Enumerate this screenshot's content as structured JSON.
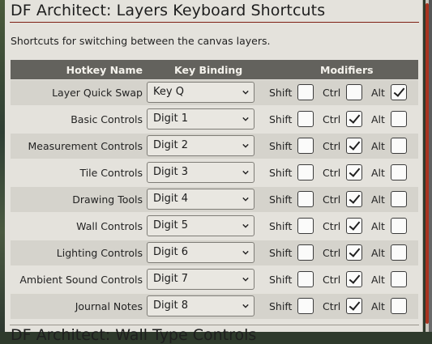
{
  "panel": {
    "title": "DF Architect: Layers Keyboard Shortcuts",
    "description": "Shortcuts for switching between the canvas layers.",
    "next_section_title": "DF Architect: Wall Type Controls"
  },
  "table": {
    "headers": {
      "name": "Hotkey Name",
      "binding": "Key Binding",
      "modifiers": "Modifiers"
    },
    "modifier_labels": {
      "shift": "Shift",
      "ctrl": "Ctrl",
      "alt": "Alt"
    },
    "rows": [
      {
        "name": "Layer Quick Swap",
        "binding": "Key Q",
        "shift": false,
        "ctrl": false,
        "alt": true
      },
      {
        "name": "Basic Controls",
        "binding": "Digit 1",
        "shift": false,
        "ctrl": true,
        "alt": false
      },
      {
        "name": "Measurement Controls",
        "binding": "Digit 2",
        "shift": false,
        "ctrl": true,
        "alt": false
      },
      {
        "name": "Tile Controls",
        "binding": "Digit 3",
        "shift": false,
        "ctrl": true,
        "alt": false
      },
      {
        "name": "Drawing Tools",
        "binding": "Digit 4",
        "shift": false,
        "ctrl": true,
        "alt": false
      },
      {
        "name": "Wall Controls",
        "binding": "Digit 5",
        "shift": false,
        "ctrl": true,
        "alt": false
      },
      {
        "name": "Lighting Controls",
        "binding": "Digit 6",
        "shift": false,
        "ctrl": true,
        "alt": false
      },
      {
        "name": "Ambient Sound Controls",
        "binding": "Digit 7",
        "shift": false,
        "ctrl": true,
        "alt": false
      },
      {
        "name": "Journal Notes",
        "binding": "Digit 8",
        "shift": false,
        "ctrl": true,
        "alt": false
      }
    ]
  },
  "colors": {
    "accent": "#7e1f13",
    "header_bg": "#63625d",
    "panel_bg": "#e4e2dc",
    "row_alt_bg": "#d5d3cc"
  },
  "icons": {
    "select_chevron": "chevron-down-icon",
    "checkbox_mark": "checkmark-icon"
  }
}
